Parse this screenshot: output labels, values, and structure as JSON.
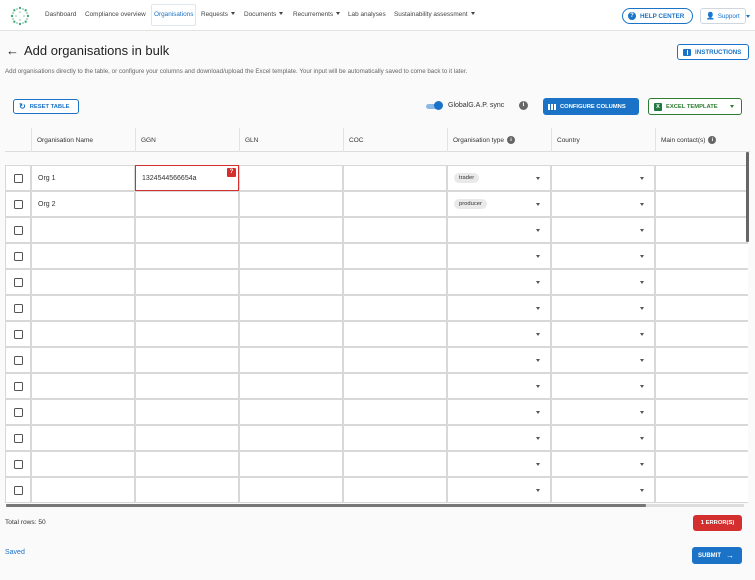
{
  "nav": {
    "logo_icon": "company-logo-dots",
    "links": [
      {
        "label": "Dashboard",
        "dropdown": false
      },
      {
        "label": "Compliance overview",
        "dropdown": false
      },
      {
        "label": "Organisations",
        "dropdown": false,
        "active": true
      },
      {
        "label": "Requests",
        "dropdown": true
      },
      {
        "label": "Documents",
        "dropdown": true
      },
      {
        "label": "Recurrements",
        "dropdown": true
      },
      {
        "label": "Lab analyses",
        "dropdown": false
      },
      {
        "label": "Sustainability assessment",
        "dropdown": true
      }
    ],
    "help_center": "HELP CENTER",
    "support": "Support"
  },
  "header": {
    "title": "Add organisations in bulk",
    "description": "Add organisations directly to the table, or configure your columns and download/upload the Excel template. Your input will be automatically saved to come back to it later.",
    "instructions_button": "INSTRUCTIONS"
  },
  "toolbar": {
    "reset_button": "RESET TABLE",
    "sync_label": "GlobalG.A.P. sync",
    "sync_enabled": true,
    "configure_button": "CONFIGURE COLUMNS",
    "excel_button": "EXCEL TEMPLATE"
  },
  "table": {
    "columns": [
      "Organisation Name",
      "GGN",
      "GLN",
      "COC",
      "Organisation type",
      "Country",
      "Main contact(s)"
    ],
    "rows": [
      {
        "name": "Org 1",
        "ggn": "1324544566654a",
        "ggn_error": true,
        "type": "trader"
      },
      {
        "name": "Org 2",
        "ggn": "",
        "ggn_error": false,
        "type": "producer"
      },
      {
        "name": "",
        "ggn": "",
        "type": ""
      },
      {
        "name": "",
        "ggn": "",
        "type": ""
      },
      {
        "name": "",
        "ggn": "",
        "type": ""
      },
      {
        "name": "",
        "ggn": "",
        "type": ""
      },
      {
        "name": "",
        "ggn": "",
        "type": ""
      },
      {
        "name": "",
        "ggn": "",
        "type": ""
      },
      {
        "name": "",
        "ggn": "",
        "type": ""
      },
      {
        "name": "",
        "ggn": "",
        "type": ""
      },
      {
        "name": "",
        "ggn": "",
        "type": ""
      },
      {
        "name": "",
        "ggn": "",
        "type": ""
      },
      {
        "name": "",
        "ggn": "",
        "type": ""
      }
    ]
  },
  "footer": {
    "total_rows": "Total rows: 50",
    "errors_button": "1 ERROR(S)",
    "saved": "Saved",
    "submit_button": "SUBMIT"
  },
  "colors": {
    "primary": "#1a73c7",
    "error": "#d32f2f",
    "excel_green": "#2e7d32"
  }
}
